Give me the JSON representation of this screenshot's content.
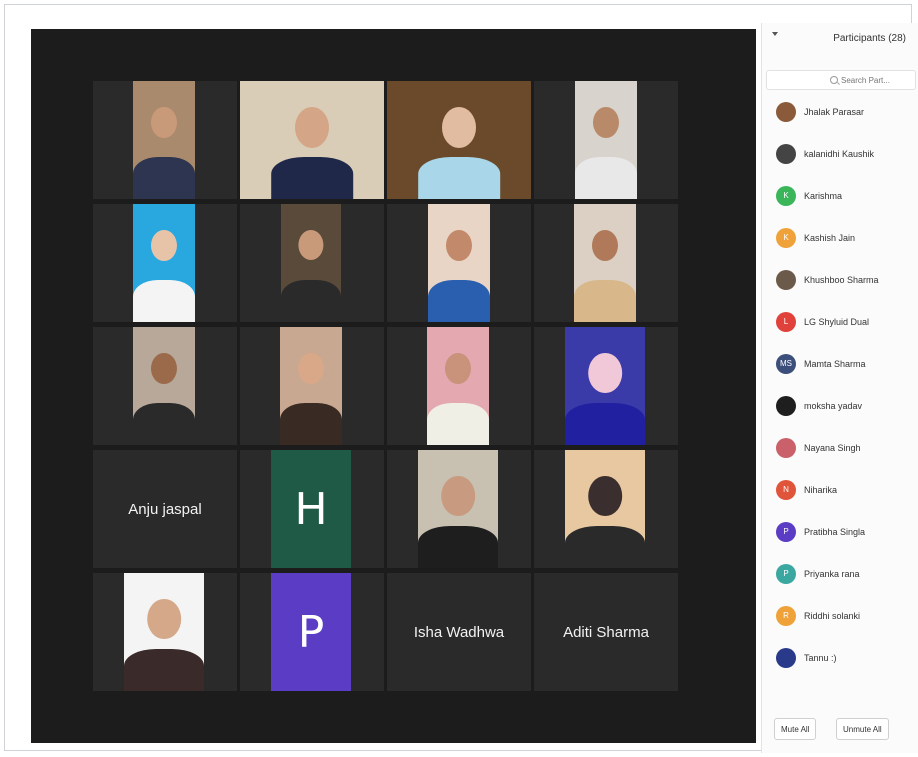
{
  "colors": {
    "video_bg": "#1c1c1c",
    "tile_bg": "#2a2a2a",
    "active_speaker": "#d8d04a",
    "avatar_h": "#1e5a45",
    "avatar_p": "#5b3cc4"
  },
  "video": {
    "tiles": [
      {
        "kind": "video",
        "row": 1,
        "col": 1
      },
      {
        "kind": "video",
        "row": 1,
        "col": 2
      },
      {
        "kind": "video",
        "row": 1,
        "col": 3,
        "active_speaker": true
      },
      {
        "kind": "video",
        "row": 1,
        "col": 4
      },
      {
        "kind": "video",
        "row": 2,
        "col": 1
      },
      {
        "kind": "video",
        "row": 2,
        "col": 2
      },
      {
        "kind": "video",
        "row": 2,
        "col": 3
      },
      {
        "kind": "video",
        "row": 2,
        "col": 4
      },
      {
        "kind": "video",
        "row": 3,
        "col": 1
      },
      {
        "kind": "video",
        "row": 3,
        "col": 2
      },
      {
        "kind": "video",
        "row": 3,
        "col": 3
      },
      {
        "kind": "video",
        "row": 3,
        "col": 4
      },
      {
        "kind": "name",
        "row": 4,
        "col": 1,
        "label": "Anju jaspal"
      },
      {
        "kind": "avatar",
        "row": 4,
        "col": 2,
        "letter": "H"
      },
      {
        "kind": "video",
        "row": 4,
        "col": 3
      },
      {
        "kind": "video",
        "row": 4,
        "col": 4
      },
      {
        "kind": "video",
        "row": 5,
        "col": 1
      },
      {
        "kind": "avatar",
        "row": 5,
        "col": 2,
        "letter": "P"
      },
      {
        "kind": "name",
        "row": 5,
        "col": 3,
        "label": "Isha Wadhwa"
      },
      {
        "kind": "name",
        "row": 5,
        "col": 4,
        "label": "Aditi Sharma"
      }
    ]
  },
  "panel": {
    "title": "Participants (28)",
    "search_placeholder": "Search Part...",
    "participants": [
      {
        "name": "Jhalak Parasar",
        "avatar": "photo",
        "color": "#8a5a3a"
      },
      {
        "name": "kalanidhi Kaushik",
        "avatar": "photo",
        "color": "#444444"
      },
      {
        "name": "Karishma",
        "avatar": "letter",
        "letter": "K",
        "color": "#3bb55a"
      },
      {
        "name": "Kashish Jain",
        "avatar": "letter",
        "letter": "K",
        "color": "#f0a23a"
      },
      {
        "name": "Khushboo Sharma",
        "avatar": "photo",
        "color": "#6b5a4a"
      },
      {
        "name": "LG Shyluid Dual",
        "avatar": "letter",
        "letter": "L",
        "color": "#e0413a"
      },
      {
        "name": "Mamta Sharma",
        "avatar": "letter",
        "letter": "MS",
        "color": "#3c4f7a"
      },
      {
        "name": "moksha yadav",
        "avatar": "photo",
        "color": "#1e1e1e"
      },
      {
        "name": "Nayana Singh",
        "avatar": "photo",
        "color": "#c9606a"
      },
      {
        "name": "Niharika",
        "avatar": "letter",
        "letter": "N",
        "color": "#e0543a"
      },
      {
        "name": "Pratibha Singla",
        "avatar": "letter",
        "letter": "P",
        "color": "#5b3cc4"
      },
      {
        "name": "Priyanka rana",
        "avatar": "letter",
        "letter": "P",
        "color": "#3aa8a0"
      },
      {
        "name": "Riddhi solanki",
        "avatar": "letter",
        "letter": "R",
        "color": "#f0a23a"
      },
      {
        "name": "Tannu :)",
        "avatar": "photo",
        "color": "#2a3a8a"
      }
    ],
    "mute_all": "Mute All",
    "unmute_all": "Unmute All"
  }
}
